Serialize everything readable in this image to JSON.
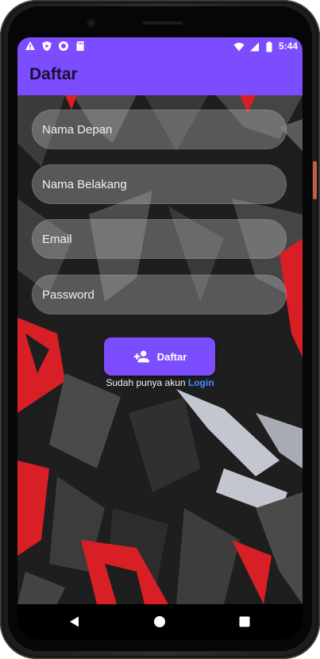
{
  "status_bar": {
    "time": "5:44",
    "left_icons": [
      "alert-icon",
      "play-shield-icon",
      "circle-dot-icon",
      "sd-card-icon"
    ],
    "right_icons": [
      "wifi-icon",
      "signal-icon",
      "battery-icon"
    ]
  },
  "app_bar": {
    "title": "Daftar"
  },
  "form": {
    "first_name": {
      "placeholder": "Nama Depan",
      "value": ""
    },
    "last_name": {
      "placeholder": "Nama Belakang",
      "value": ""
    },
    "email": {
      "placeholder": "Email",
      "value": ""
    },
    "password": {
      "placeholder": "Password",
      "value": ""
    }
  },
  "register_button": {
    "label": "Daftar",
    "icon": "person-add-icon"
  },
  "login_prompt": {
    "text": "Sudah punya akun",
    "link": "Login"
  },
  "nav_bar": {
    "icons": [
      "back-triangle-icon",
      "home-circle-icon",
      "recents-square-icon"
    ]
  },
  "colors": {
    "primary": "#7c4dff",
    "link": "#3d8bff",
    "accent_red": "#e0222a"
  }
}
